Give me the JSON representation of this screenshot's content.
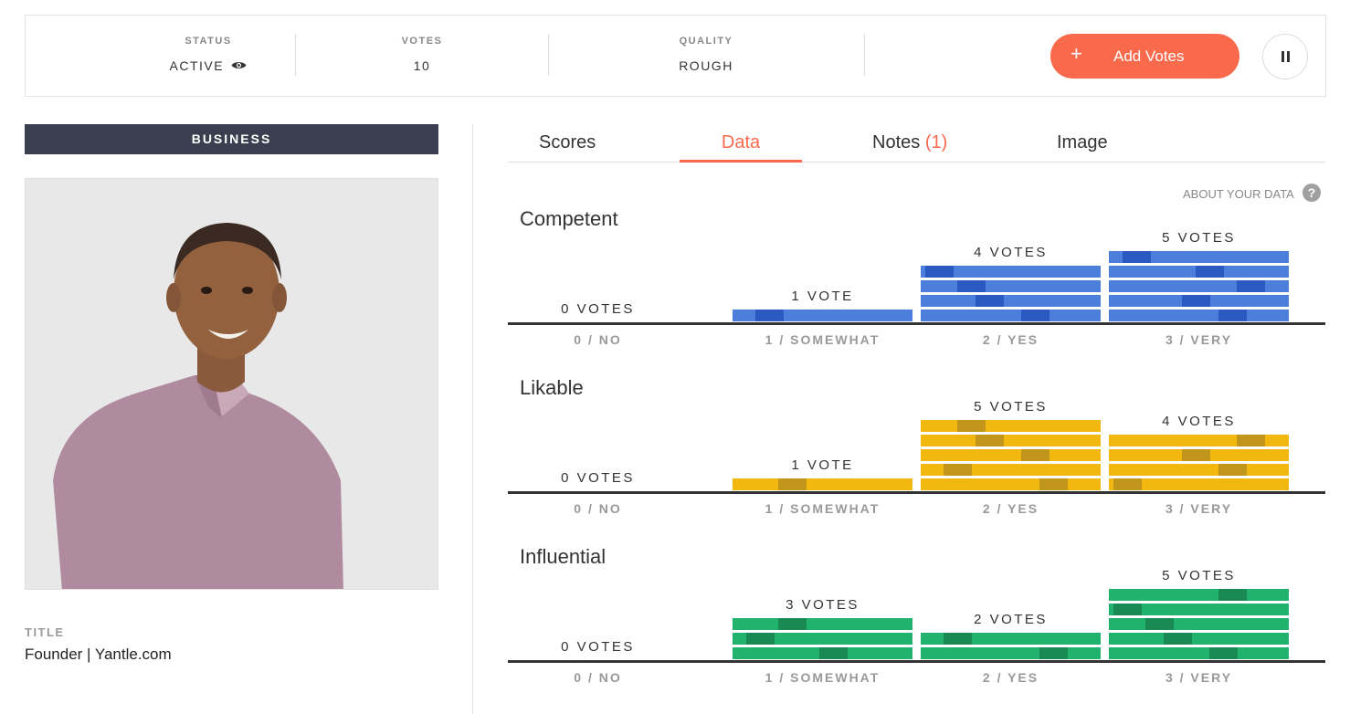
{
  "status_bar": {
    "status_label": "STATUS",
    "status_value": "ACTIVE",
    "votes_label": "VOTES",
    "votes_value": "10",
    "quality_label": "QUALITY",
    "quality_value": "ROUGH",
    "add_votes_label": "Add Votes",
    "add_icon": "+"
  },
  "left_panel": {
    "category": "BUSINESS",
    "title_label": "TITLE",
    "title_value": "Founder | Yantle.com"
  },
  "tabs": [
    {
      "label": "Scores",
      "active": false
    },
    {
      "label": "Data",
      "active": true
    },
    {
      "label": "Notes",
      "count": "(1)",
      "active": false
    },
    {
      "label": "Image",
      "active": false
    }
  ],
  "about_link": "ABOUT YOUR DATA",
  "help_icon": "?",
  "colors": {
    "accent": "#f96a4d",
    "competent": "#4c7fdb",
    "competent_mark": "#2a59c2",
    "likable": "#f3b80f",
    "likable_mark": "#c2961b",
    "influential": "#21b36d",
    "influential_mark": "#1a8a54",
    "category_bg": "#3a3f4f"
  },
  "chart_data": [
    {
      "type": "bar",
      "title": "Competent",
      "categories": [
        "0 / NO",
        "1 / SOMEWHAT",
        "2 / YES",
        "3 / VERY"
      ],
      "values": [
        0,
        1,
        4,
        5
      ],
      "value_labels": [
        "0 VOTES",
        "1 VOTE",
        "4 VOTES",
        "5 VOTES"
      ]
    },
    {
      "type": "bar",
      "title": "Likable",
      "categories": [
        "0 / NO",
        "1 / SOMEWHAT",
        "2 / YES",
        "3 / VERY"
      ],
      "values": [
        0,
        1,
        5,
        4
      ],
      "value_labels": [
        "0 VOTES",
        "1 VOTE",
        "5 VOTES",
        "4 VOTES"
      ]
    },
    {
      "type": "bar",
      "title": "Influential",
      "categories": [
        "0 / NO",
        "1 / SOMEWHAT",
        "2 / YES",
        "3 / VERY"
      ],
      "values": [
        0,
        3,
        2,
        5
      ],
      "value_labels": [
        "0 VOTES",
        "3 VOTES",
        "2 VOTES",
        "5 VOTES"
      ]
    }
  ]
}
